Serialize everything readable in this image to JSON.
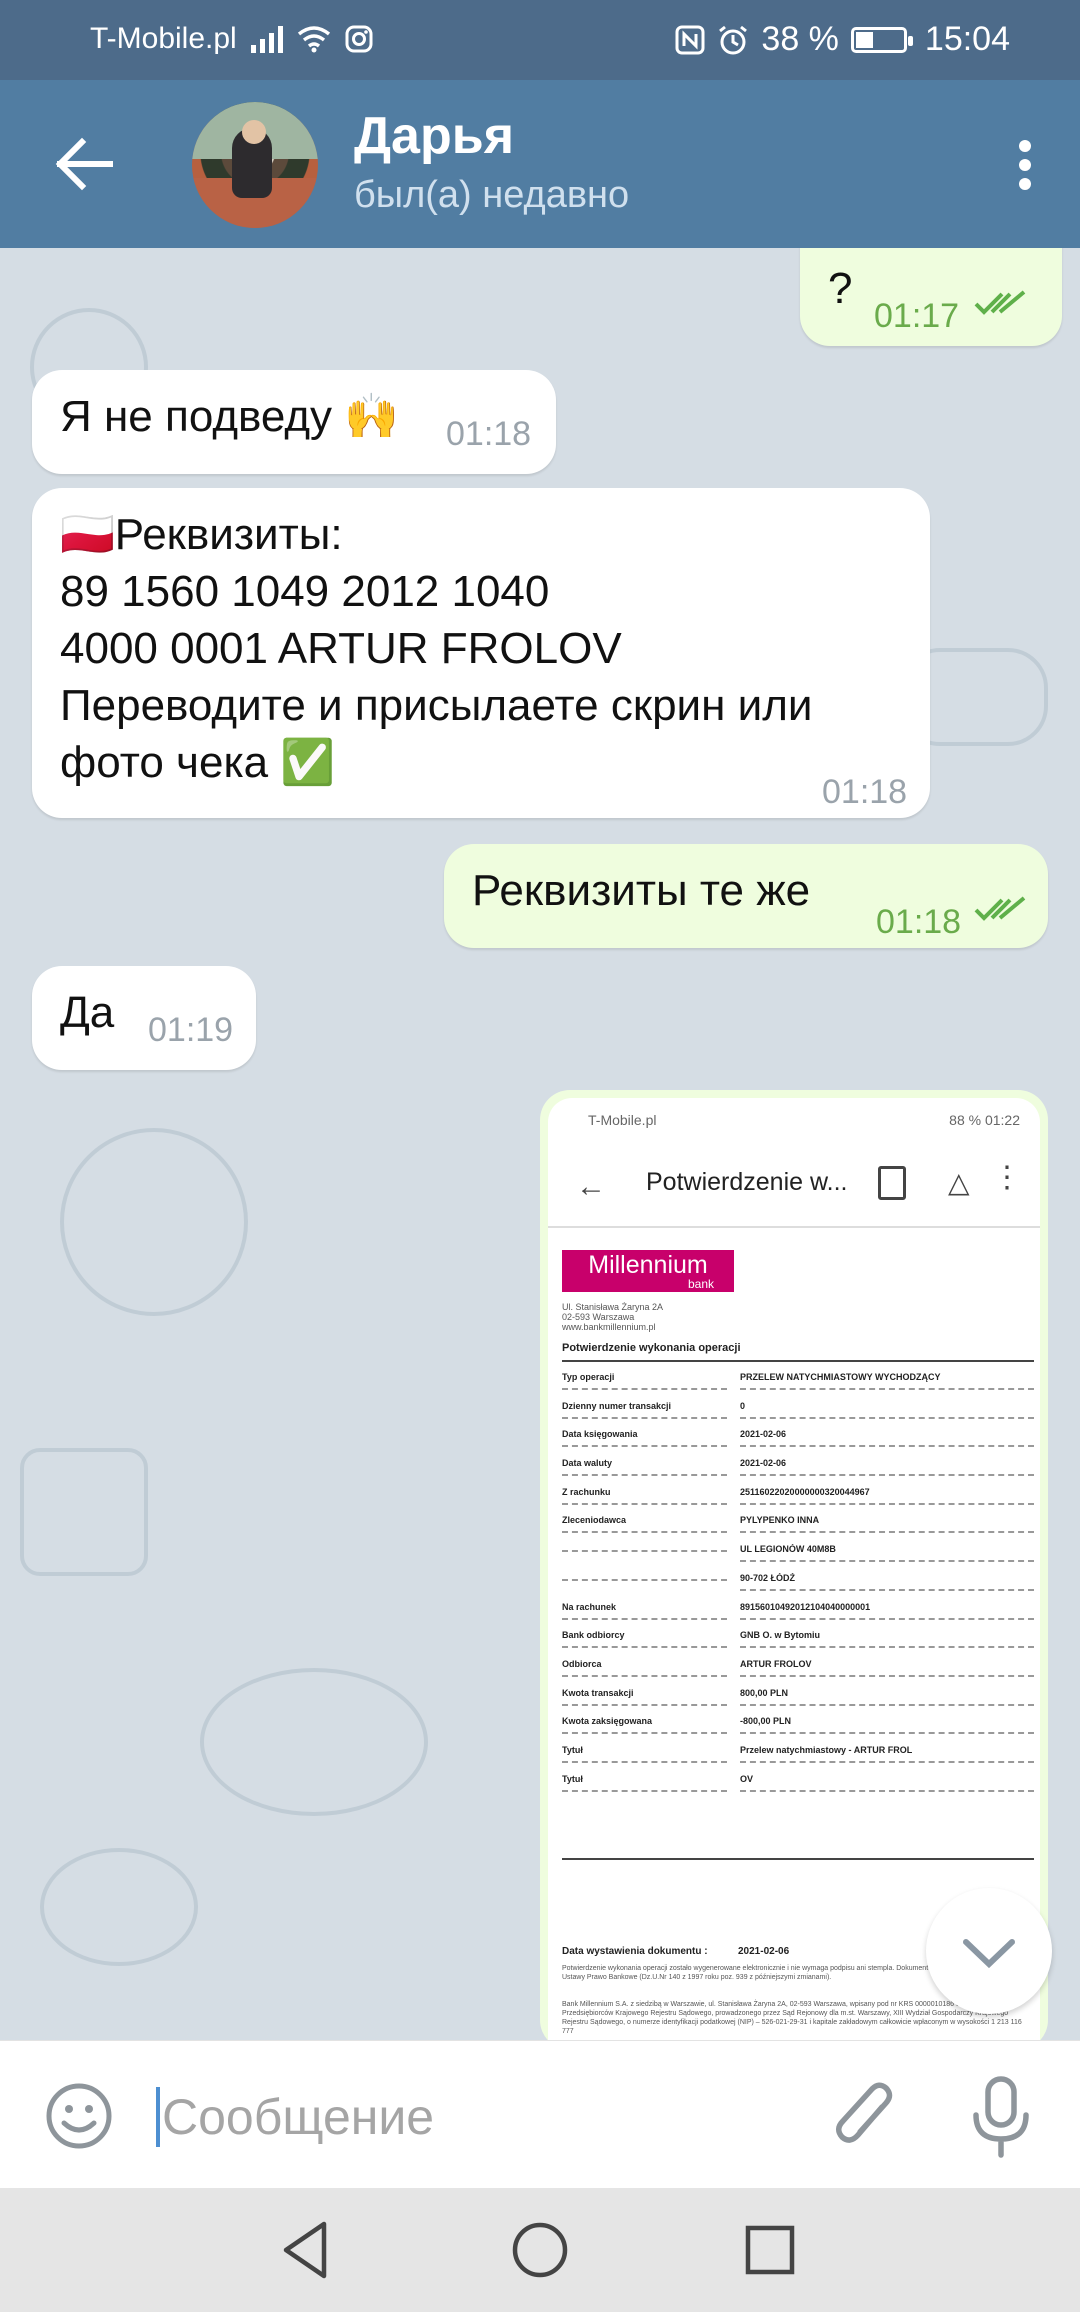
{
  "status_bar": {
    "carrier": "T-Mobile.pl",
    "battery": "38 %",
    "battery_level": 0.38,
    "time": "15:04"
  },
  "header": {
    "contact_name": "Дарья",
    "contact_status": "был(а) недавно"
  },
  "messages": [
    {
      "dir": "out",
      "text": "?",
      "time": "01:17",
      "read": true
    },
    {
      "dir": "in",
      "text": "Я не подведу 🙌",
      "time": "01:18"
    },
    {
      "dir": "in",
      "lines": [
        "🇵🇱Реквизиты:",
        "89 1560 1049 2012 1040",
        "4000 0001  ARTUR FROLOV",
        "Переводите и присылаете скрин или",
        "фото чека ✅"
      ],
      "time": "01:18"
    },
    {
      "dir": "out",
      "text": "Реквизиты те же",
      "time": "01:18",
      "read": true
    },
    {
      "dir": "in",
      "text": "Да",
      "time": "01:19"
    }
  ],
  "photo_message": {
    "status_carrier": "T-Mobile.pl",
    "status_right": "88 %  01:22",
    "toolbar_title": "Potwierdzenie w...",
    "bank_logo": "Millennium",
    "bank_logo_sub": "bank",
    "address": [
      "Ul. Stanisława Żaryna 2A",
      "02-593 Warszawa",
      "www.bankmillennium.pl"
    ],
    "doc_title": "Potwierdzenie wykonania operacji",
    "rows": [
      {
        "k": "Typ operacji",
        "v": "PRZELEW NATYCHMIASTOWY WYCHODZĄCY"
      },
      {
        "k": "Dzienny numer transakcji",
        "v": "0"
      },
      {
        "k": "Data księgowania",
        "v": "2021-02-06"
      },
      {
        "k": "Data waluty",
        "v": "2021-02-06"
      },
      {
        "k": "Z rachunku",
        "v": "25116022020000000320044967"
      },
      {
        "k": "Zleceniodawca",
        "v": "PYLYPENKO INNA"
      },
      {
        "k": "",
        "v": "UL LEGIONÓW 40M8B"
      },
      {
        "k": "",
        "v": "90-702 ŁÓDŹ"
      },
      {
        "k": "Na rachunek",
        "v": "89156010492012104040000001"
      },
      {
        "k": "Bank odbiorcy",
        "v": "GNB O. w Bytomiu"
      },
      {
        "k": "Odbiorca",
        "v": "ARTUR FROLOV"
      },
      {
        "k": "Kwota transakcji",
        "v": "800,00 PLN"
      },
      {
        "k": "Kwota zaksięgowana",
        "v": "-800,00 PLN"
      },
      {
        "k": "Tytuł",
        "v": "Przelew natychmiastowy - ARTUR FROL"
      },
      {
        "k": "Tytuł",
        "v": "OV"
      }
    ],
    "issue_label": "Data wystawienia dokumentu :",
    "issue_date": "2021-02-06",
    "fineprint_1": "Potwierdzenie wykonania operacji zostało wygenerowane elektronicznie i nie wymaga podpisu ani stempla. Dokument wygenerowany zgodnie z art. 7 Ustawy Prawo Bankowe (Dz.U.Nr 140 z 1997 roku poz. 939 z późniejszymi zmianami).",
    "fineprint_2": "Bank Millennium S.A. z siedzibą w Warszawie, ul. Stanisława Żaryna 2A, 02-593 Warszawa, wpisany pod nr KRS 0000010186 do Rejestru Przedsiębiorców Krajowego Rejestru Sądowego, prowadzonego przez Sąd Rejonowy dla m.st. Warszawy, XIII Wydział Gospodarczy Krajowego Rejestru Sądowego, o numerze identyfikacji podatkowej (NIP) – 526-021-29-31 i kapitale zakładowym całkowicie wpłaconym w wysokości 1 213 116 777"
  },
  "input": {
    "placeholder": "Сообщение"
  },
  "colors": {
    "header": "#517da2",
    "status_bar": "#4d6b8a",
    "outgoing_bubble": "#effdde",
    "incoming_bubble": "#ffffff",
    "outgoing_time": "#6aab4b"
  }
}
